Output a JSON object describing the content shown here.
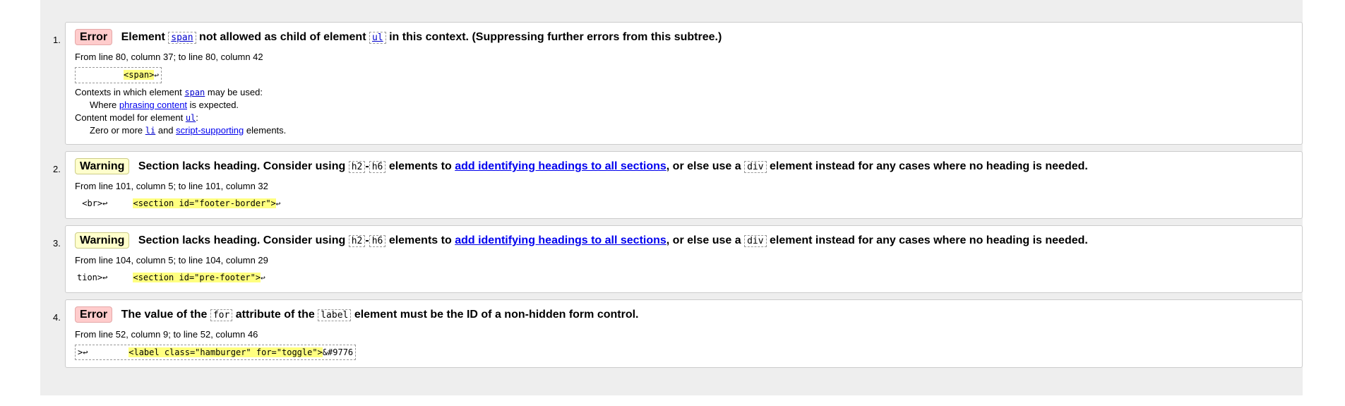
{
  "messages": [
    {
      "num": "1.",
      "type": "Error",
      "text_1": "Element",
      "code_1": "span",
      "text_2": "not allowed as child of element",
      "code_2": "ul",
      "text_3": "in this context. (Suppressing further errors from this subtree.)",
      "location": "From line 80, column 37; to line 80, column 42",
      "extract_pre": "         ",
      "extract_hl": "<span>",
      "extract_post": "↩",
      "ctx_label": "Contexts in which element",
      "ctx_code": "span",
      "ctx_suffix": "may be used:",
      "where_prefix": "Where",
      "where_link": "phrasing content",
      "where_suffix": "is expected.",
      "model_label": "Content model for element",
      "model_code": "ul",
      "model_colon": ":",
      "zero_prefix": "Zero or more",
      "zero_code": "li",
      "zero_and": "and",
      "zero_link": "script-supporting",
      "zero_suffix": "elements."
    },
    {
      "num": "2.",
      "type": "Warning",
      "text_1": "Section lacks heading. Consider using",
      "code_1": "h2",
      "dash": "-",
      "code_2": "h6",
      "text_2": "elements to",
      "link": "add identifying headings to all sections",
      "text_3": ", or else use a",
      "code_3": "div",
      "text_4": "element instead for any cases where no heading is needed.",
      "location": "From line 101, column 5; to line 101, column 32",
      "extract_pre": " <br>↩     ",
      "extract_hl": "<section id=\"footer-border\">",
      "extract_post": "↩"
    },
    {
      "num": "3.",
      "type": "Warning",
      "text_1": "Section lacks heading. Consider using",
      "code_1": "h2",
      "dash": "-",
      "code_2": "h6",
      "text_2": "elements to",
      "link": "add identifying headings to all sections",
      "text_3": ", or else use a",
      "code_3": "div",
      "text_4": "element instead for any cases where no heading is needed.",
      "location": "From line 104, column 5; to line 104, column 29",
      "extract_pre": "tion>↩     ",
      "extract_hl": "<section id=\"pre-footer\">",
      "extract_post": "↩"
    },
    {
      "num": "4.",
      "type": "Error",
      "text_1": "The value of the",
      "code_1": "for",
      "text_2": "attribute of the",
      "code_2": "label",
      "text_3": "element must be the ID of a non-hidden form control.",
      "location": "From line 52, column 9; to line 52, column 46",
      "extract_pre": ">↩        ",
      "extract_hl": "<label class=\"hamburger\" for=\"toggle\">",
      "extract_post": "&#9776"
    }
  ]
}
